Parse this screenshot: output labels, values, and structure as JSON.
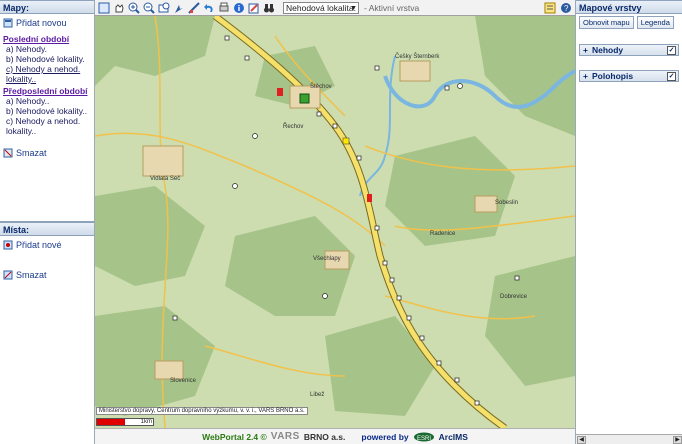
{
  "maps": {
    "title": "Mapy:",
    "add_label": "Přidat novou",
    "last_period_title": "Poslední období",
    "last_period_items": [
      "a) Nehody.",
      "b) Nehodové lokality.",
      "c) Nehody a nehod. lokality.."
    ],
    "prev_period_title": "Předposlední období",
    "prev_period_items": [
      "a) Nehody..",
      "b) Nehodové lokality..",
      "c) Nehody a nehod. lokality.."
    ],
    "delete_label": "Smazat"
  },
  "places": {
    "title": "Místa:",
    "add_label": "Přidat nové",
    "delete_label": "Smazat"
  },
  "toolbar": {
    "layer_value": "Nehodová lokalita.",
    "active_layer_label": "- Aktivní vrstva"
  },
  "map": {
    "labels": [
      "Štěchov",
      "Vidlatá Seč",
      "Všechlapy",
      "Slovenice",
      "Sobeslin",
      "Radenice",
      "Dobrevice",
      "Libež",
      "Češky Šternberk",
      "Řechov"
    ],
    "credit": "Ministerstvo dopravy, Centrum dopravního výzkumu, v. v. i., VARS BRNO a.s.",
    "scale": "1km",
    "colors": {
      "land": "#cdddb0",
      "forest": "#a6c48a",
      "water": "#7ab6e0",
      "road": "#f2c14a",
      "highway": "#f4e06a"
    }
  },
  "status": {
    "app": "WebPortal 2.4 ©",
    "vars": "VARS",
    "brno": "BRNO a.s.",
    "powered": "powered by",
    "esri": "ESRI",
    "arcims": "ArcIMS"
  },
  "layers": {
    "title": "Mapové vrstvy",
    "refresh_label": "Obnovit mapu",
    "legend_label": "Legenda",
    "items": [
      {
        "label": "Nehody",
        "checked": true
      },
      {
        "label": "Polohopis",
        "checked": true
      }
    ]
  }
}
